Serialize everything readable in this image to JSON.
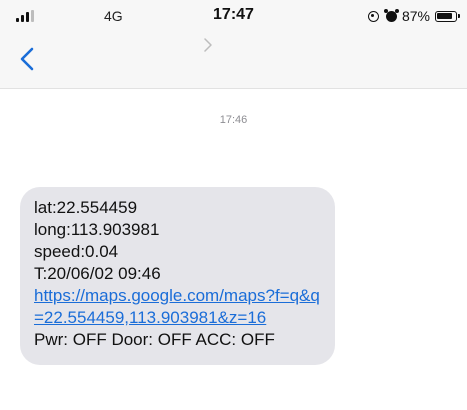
{
  "status_bar": {
    "network_type": "4G",
    "time": "17:47",
    "battery_percent": "87%"
  },
  "nav": {
    "back_icon": "chevron-left-icon",
    "contact_chevron_icon": "chevron-right-icon"
  },
  "conversation": {
    "timestamp": "17:46",
    "message": {
      "lines_before_link": [
        "lat:22.554459",
        "long:113.903981",
        "speed:0.04",
        "T:20/06/02 09:46"
      ],
      "link_text": "https://maps.google.com/maps?f=q&q=22.554459,113.903981&z=16",
      "line_after_link": "Pwr: OFF Door: OFF ACC: OFF"
    }
  },
  "colors": {
    "accent": "#1a6dd8",
    "bubble": "#e5e5ea",
    "timestamp": "#8e8e93"
  }
}
